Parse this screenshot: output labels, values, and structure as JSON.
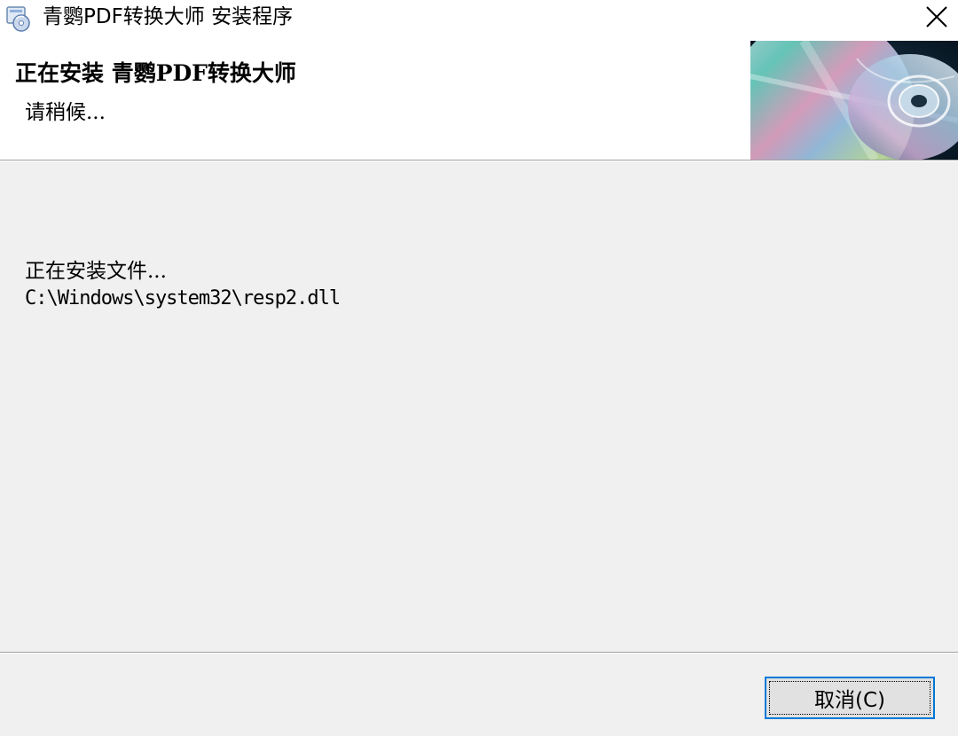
{
  "window": {
    "title": "青鹦PDF转换大师 安装程序",
    "app_icon": "installer-cd-icon",
    "close_icon": "close-icon"
  },
  "header": {
    "title": "正在安装 青鹦PDF转换大师",
    "subtitle": "请稍候...",
    "image": "cd-disc-image"
  },
  "body": {
    "status": "正在安装文件...",
    "current_file": "C:\\Windows\\system32\\resp2.dll"
  },
  "footer": {
    "cancel_label": "取消(C)"
  },
  "colors": {
    "body_bg": "#f0f0f0",
    "header_bg": "#ffffff",
    "button_focus_border": "#0078d7",
    "button_bg": "#e1e1e1"
  }
}
